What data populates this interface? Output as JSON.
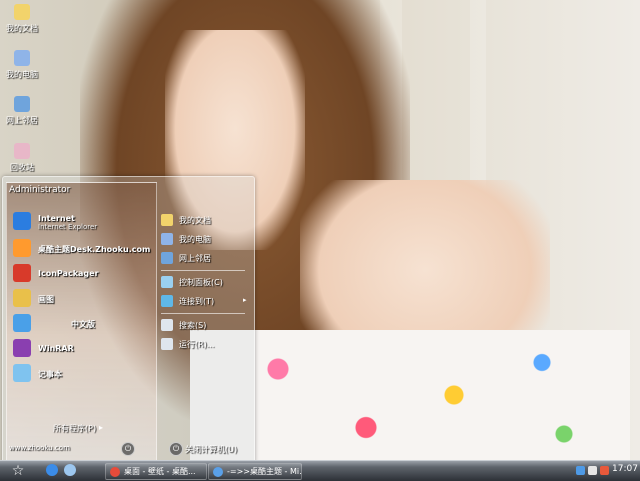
{
  "desktop": {
    "icons": [
      {
        "label": "我的文档",
        "icon": "folder-icon",
        "color": "#f2d36b"
      },
      {
        "label": "我的电脑",
        "icon": "computer-icon",
        "color": "#8fb4e8"
      },
      {
        "label": "网上邻居",
        "icon": "network-icon",
        "color": "#6fa4dc"
      },
      {
        "label": "回收站",
        "icon": "recycle-bin-icon",
        "color": "#e8b7c8"
      }
    ]
  },
  "start_menu": {
    "user": "Administrator",
    "programs": [
      {
        "label": "Internet",
        "sub": "Internet Explorer",
        "icon": "ie-icon",
        "color": "#2b7de0"
      },
      {
        "label": "桌酷主题Desk.Zhooku.com",
        "sub": "",
        "icon": "theme-icon",
        "color": "#ff9a2e"
      },
      {
        "label": "IconPackager",
        "sub": "",
        "icon": "iconpackager-icon",
        "color": "#d83a2a"
      },
      {
        "label": "画图",
        "sub": "",
        "icon": "paint-icon",
        "color": "#e9c04a"
      },
      {
        "label": "中文版",
        "sub": "",
        "icon": "app-icon",
        "color": "#4aa0e8"
      },
      {
        "label": "WinRAR",
        "sub": "",
        "icon": "winrar-icon",
        "color": "#8a3fb0"
      },
      {
        "label": "记事本",
        "sub": "",
        "icon": "notepad-icon",
        "color": "#7fc3ef"
      }
    ],
    "all_programs": "所有程序(P)",
    "footer_url": "www.zhooku.com",
    "places": [
      {
        "label": "我的文档",
        "icon": "documents-icon",
        "color": "#f2d36b"
      },
      {
        "label": "我的电脑",
        "icon": "computer-icon",
        "color": "#8fb4e8"
      },
      {
        "label": "网上邻居",
        "icon": "network-icon",
        "color": "#6fa4dc"
      }
    ],
    "settings": [
      {
        "label": "控制面板(C)",
        "icon": "control-panel-icon",
        "color": "#9ad0f0"
      },
      {
        "label": "连接到(T)",
        "icon": "connect-icon",
        "color": "#5fb8e8",
        "arrow": "▸"
      }
    ],
    "tools": [
      {
        "label": "搜索(S)",
        "icon": "search-icon",
        "color": "#dfe6ee"
      },
      {
        "label": "运行(R)...",
        "icon": "run-icon",
        "color": "#dfe6ee"
      }
    ],
    "shutdown": "关闭计算机(U)"
  },
  "taskbar": {
    "start_glyph": "☆",
    "quick_launch": [
      {
        "icon": "ie-icon",
        "color": "#3b8ce8"
      },
      {
        "icon": "show-desktop-icon",
        "color": "#9cc6ee"
      }
    ],
    "buttons": [
      {
        "label": "桌面 - 壁纸 - 桌酷...",
        "icon": "browser-icon",
        "color": "#e84b3a"
      },
      {
        "label": "-=>>桌酷主题 - Mi...",
        "icon": "window-icon",
        "color": "#5aa0e8"
      }
    ],
    "tray_icons": [
      {
        "icon": "network-tray-icon",
        "color": "#4e9ae6"
      },
      {
        "icon": "volume-icon",
        "color": "#e5e5e5"
      },
      {
        "icon": "security-icon",
        "color": "#e8593b"
      }
    ],
    "clock": "17:07"
  }
}
